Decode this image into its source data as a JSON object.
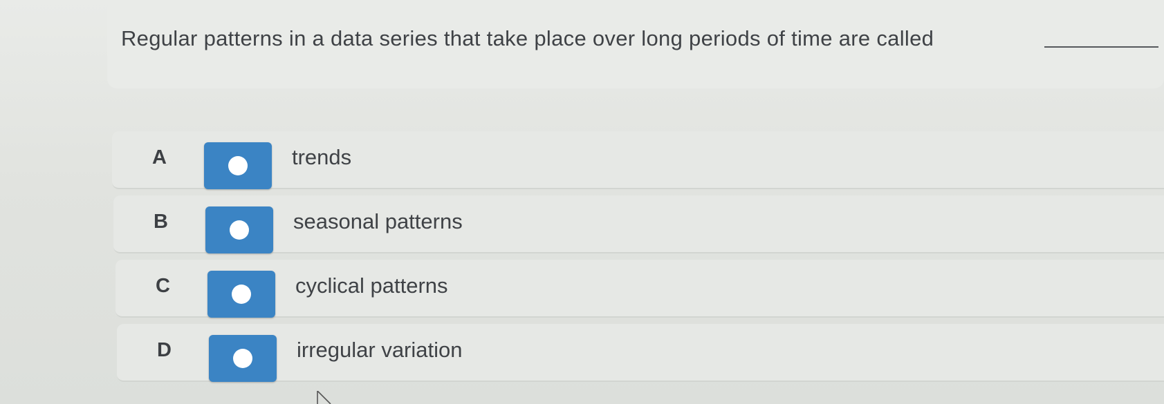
{
  "question": {
    "text": "Regular patterns in a data series that take place over long periods of time are called"
  },
  "options": [
    {
      "letter": "A",
      "text": "trends"
    },
    {
      "letter": "B",
      "text": "seasonal patterns"
    },
    {
      "letter": "C",
      "text": "cyclical patterns"
    },
    {
      "letter": "D",
      "text": "irregular variation"
    }
  ],
  "colors": {
    "radio_button": "#3b84c4",
    "text": "#3f4246",
    "background": "#e4e6e2"
  }
}
